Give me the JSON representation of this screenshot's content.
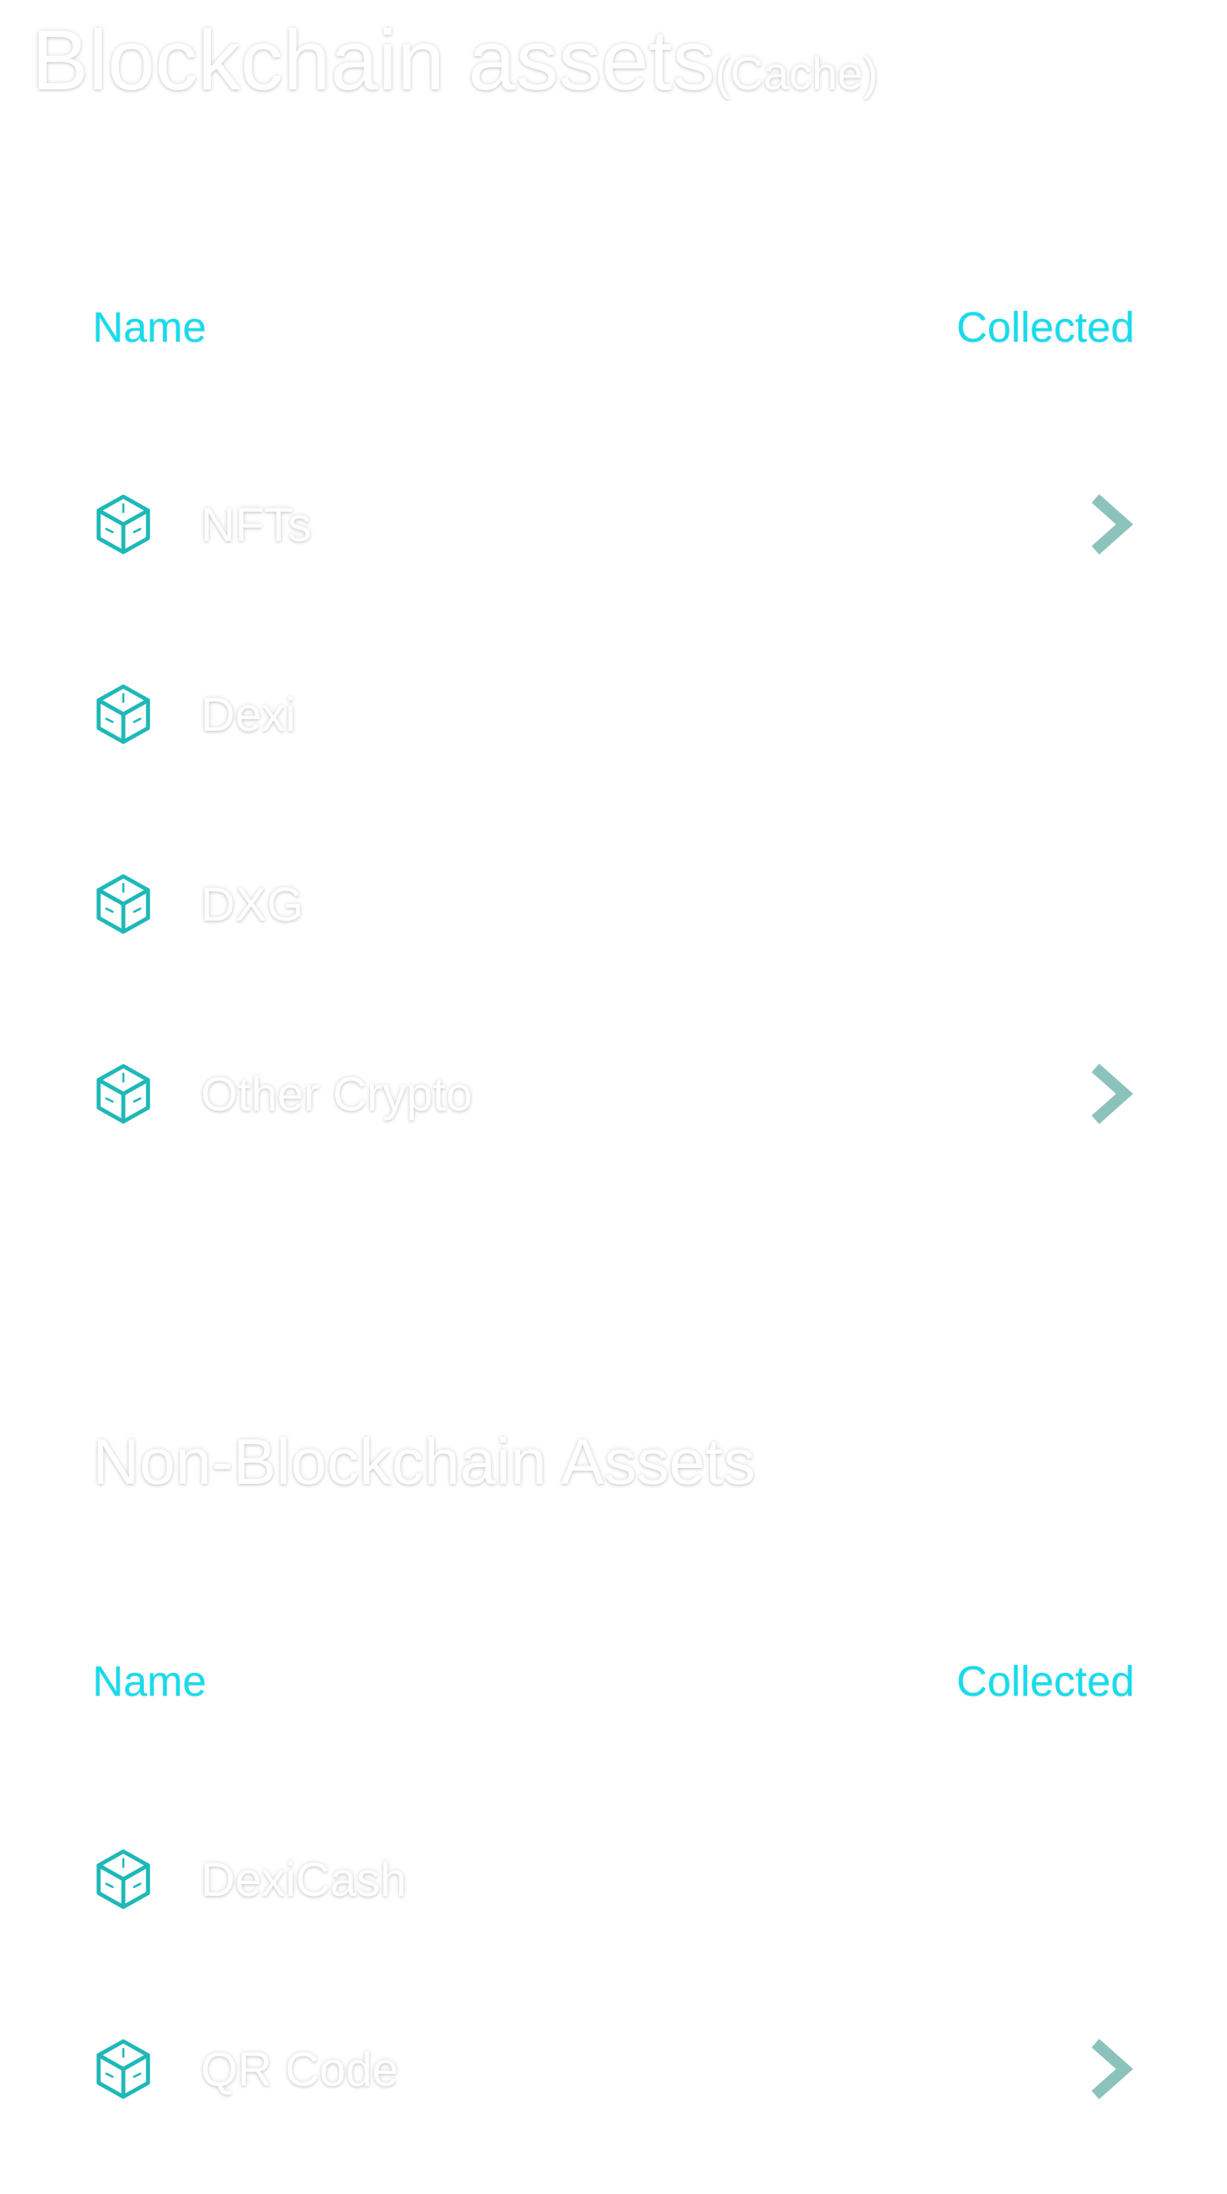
{
  "colors": {
    "accent": "#15dcec",
    "icon": "#1fb8b8",
    "chevron": "#8cc2bc",
    "text": "#ffffff"
  },
  "blockchain": {
    "title": "Blockchain assets",
    "title_suffix": "(Cache)",
    "columns": {
      "name": "Name",
      "collected": "Collected"
    },
    "items": [
      {
        "label": "NFTs",
        "icon": "cube-icon",
        "has_chevron": true
      },
      {
        "label": "Dexi",
        "icon": "cube-icon",
        "has_chevron": false
      },
      {
        "label": "DXG",
        "icon": "cube-icon",
        "has_chevron": false
      },
      {
        "label": "Other Crypto",
        "icon": "cube-icon",
        "has_chevron": true
      }
    ]
  },
  "non_blockchain": {
    "title": "Non-Blockchain Assets",
    "columns": {
      "name": "Name",
      "collected": "Collected"
    },
    "items": [
      {
        "label": "DexiCash",
        "icon": "cube-icon",
        "has_chevron": false
      },
      {
        "label": "QR Code",
        "icon": "cube-icon",
        "has_chevron": true
      }
    ]
  }
}
